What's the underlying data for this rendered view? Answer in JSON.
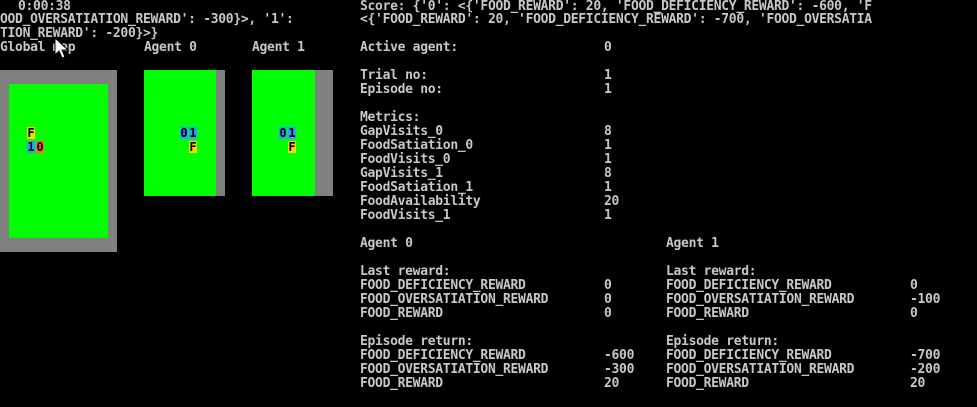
{
  "header": {
    "time": "0:00:38",
    "left_line1": "OOD_OVERSATIATION_REWARD': -300}>, '1':",
    "left_line2": "TION_REWARD': -200}>}",
    "score_line1": "Score: {'0': <{'FOOD_REWARD': 20, 'FOOD_DEFICIENCY_REWARD': -600, 'F",
    "score_line2": "<{'FOOD_REWARD': 20, 'FOOD_DEFICIENCY_REWARD': -700, 'FOOD_OVERSATIA"
  },
  "maps": {
    "global_title": "Global map",
    "agent0_title": "Agent 0",
    "agent1_title": "Agent 1",
    "global_cells": [
      "F",
      "1",
      "0"
    ],
    "agent0_cells": [
      "0",
      "1",
      "F"
    ],
    "agent1_cells": [
      "0",
      "1",
      "F"
    ]
  },
  "status": {
    "active_agent_label": "Active agent:",
    "active_agent_value": "0",
    "trial_label": "Trial no:",
    "trial_value": "1",
    "episode_label": "Episode no:",
    "episode_value": "1"
  },
  "metrics": {
    "title": "Metrics:",
    "items": [
      {
        "name": "GapVisits_0",
        "value": "8"
      },
      {
        "name": "FoodSatiation_0",
        "value": "1"
      },
      {
        "name": "FoodVisits_0",
        "value": "1"
      },
      {
        "name": "GapVisits_1",
        "value": "8"
      },
      {
        "name": "FoodSatiation_1",
        "value": "1"
      },
      {
        "name": "FoodAvailability",
        "value": "20"
      },
      {
        "name": "FoodVisits_1",
        "value": "1"
      }
    ]
  },
  "agents": [
    {
      "title": "Agent 0",
      "last_reward_title": "Last reward:",
      "last_reward": [
        {
          "name": "FOOD_DEFICIENCY_REWARD",
          "value": "0"
        },
        {
          "name": "FOOD_OVERSATIATION_REWARD",
          "value": "0"
        },
        {
          "name": "FOOD_REWARD",
          "value": "0"
        }
      ],
      "episode_return_title": "Episode return:",
      "episode_return": [
        {
          "name": "FOOD_DEFICIENCY_REWARD",
          "value": "-600"
        },
        {
          "name": "FOOD_OVERSATIATION_REWARD",
          "value": "-300"
        },
        {
          "name": "FOOD_REWARD",
          "value": "20"
        }
      ]
    },
    {
      "title": "Agent 1",
      "last_reward_title": "Last reward:",
      "last_reward": [
        {
          "name": "FOOD_DEFICIENCY_REWARD",
          "value": "0"
        },
        {
          "name": "FOOD_OVERSATIATION_REWARD",
          "value": "-100"
        },
        {
          "name": "FOOD_REWARD",
          "value": "0"
        }
      ],
      "episode_return_title": "Episode return:",
      "episode_return": [
        {
          "name": "FOOD_DEFICIENCY_REWARD",
          "value": "-700"
        },
        {
          "name": "FOOD_OVERSATIATION_REWARD",
          "value": "-200"
        },
        {
          "name": "FOOD_REWARD",
          "value": "20"
        }
      ]
    }
  ],
  "colors": {
    "background": "#000000",
    "text": "#c8c8c8",
    "grass": "#00ff00",
    "wall": "#808080",
    "food": "#ffd200",
    "agent": "#2aa0ff",
    "agent_alt": "#ff6a2a"
  }
}
